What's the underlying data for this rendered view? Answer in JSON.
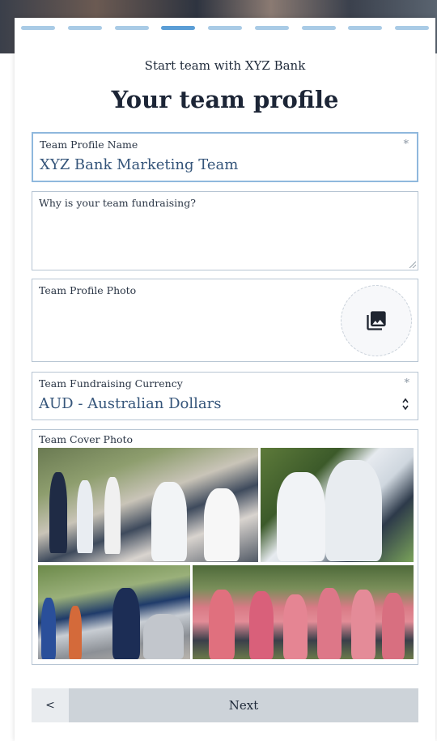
{
  "progress": {
    "total_steps": 9,
    "current_step": 4
  },
  "header": {
    "subtitle": "Start team with XYZ Bank",
    "title": "Your team profile"
  },
  "form": {
    "team_name": {
      "label": "Team Profile Name",
      "required_mark": "*",
      "value": "XYZ Bank Marketing Team"
    },
    "reason": {
      "label": "Why is your team fundraising?",
      "value": ""
    },
    "profile_photo": {
      "label": "Team Profile Photo",
      "icon": "photo-library-icon"
    },
    "currency": {
      "label": "Team Fundraising Currency",
      "required_mark": "*",
      "value": "AUD - Australian Dollars"
    },
    "cover_photo": {
      "label": "Team Cover Photo"
    }
  },
  "nav": {
    "back_label": "<",
    "next_label": "Next"
  },
  "colors": {
    "progress_active": "#5b9ed6",
    "progress_inactive": "#a9cbe6",
    "focus_border": "#8fb8dd",
    "button_bg": "#cdd3d9"
  }
}
